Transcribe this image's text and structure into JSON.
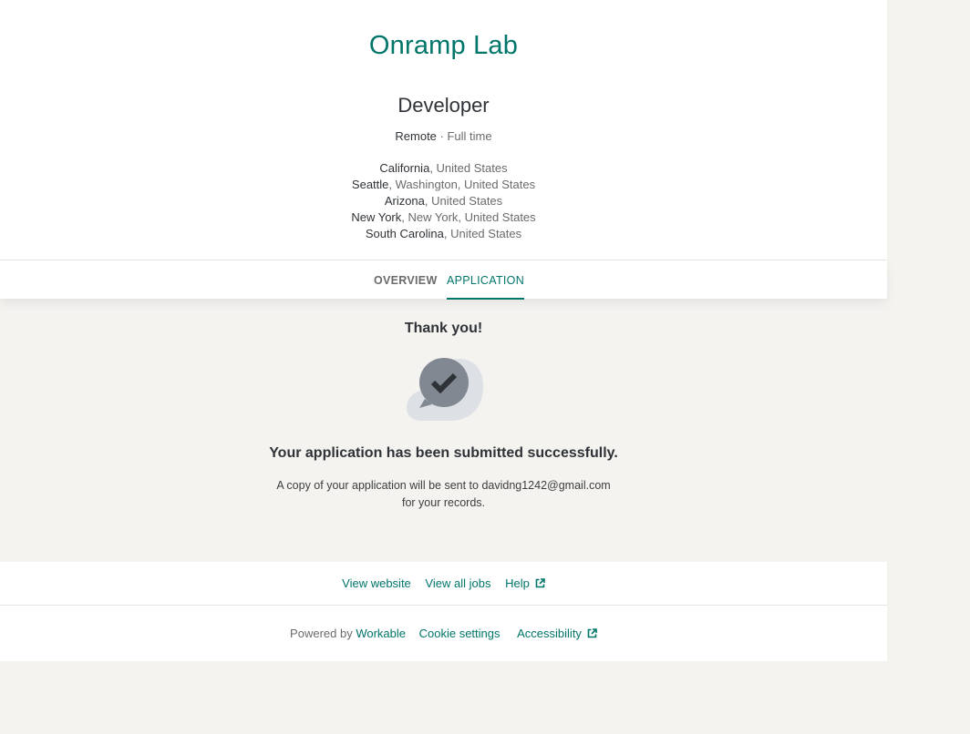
{
  "company": {
    "name": "Onramp Lab"
  },
  "job": {
    "title": "Developer",
    "workplace": "Remote",
    "separator": " · ",
    "type": "Full time",
    "locations": [
      {
        "city": "California",
        "rest": ", United States"
      },
      {
        "city": "Seattle",
        "rest": ", Washington, United States"
      },
      {
        "city": "Arizona",
        "rest": ", United States"
      },
      {
        "city": "New York",
        "rest": ", New York, United States"
      },
      {
        "city": "South Carolina",
        "rest": ", United States"
      }
    ]
  },
  "tabs": {
    "overview": "OVERVIEW",
    "application": "APPLICATION"
  },
  "confirmation": {
    "thanks": "Thank you!",
    "title": "Your application has been submitted successfully.",
    "line1": "A copy of your application will be sent to davidng1242@gmail.com",
    "line2": "for your records.",
    "icon": "chat-check-icon"
  },
  "footer": {
    "view_website": "View website",
    "view_all_jobs": "View all jobs",
    "help": "Help",
    "powered_by": "Powered by ",
    "workable": "Workable",
    "cookie_settings": "Cookie settings",
    "accessibility": "Accessibility"
  },
  "colors": {
    "accent": "#00756a",
    "background": "#f4f3f0",
    "icon_bubble": "#828891",
    "icon_bg": "#dde1e6"
  }
}
